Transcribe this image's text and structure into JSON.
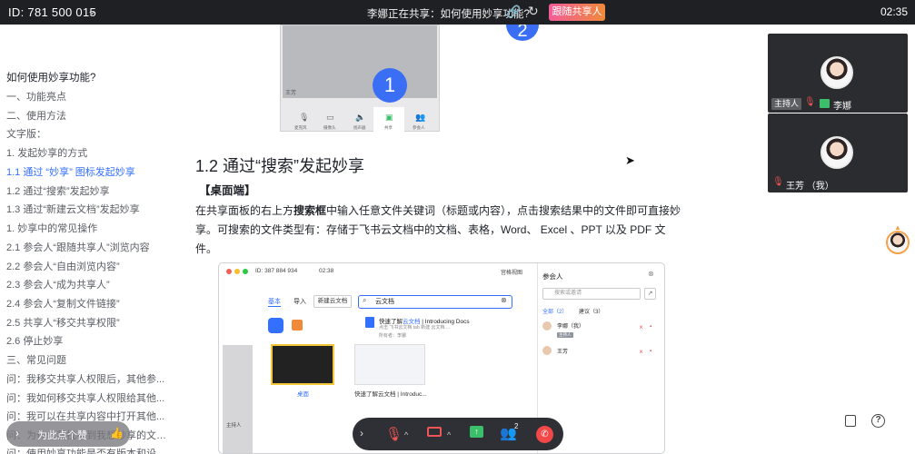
{
  "topbar": {
    "meeting_id": "ID: 781 500 015",
    "sharing_status": "李娜正在共享：如何使用妙享功能?",
    "follow_button": "跟随共享人",
    "clock": "02:35"
  },
  "outline": {
    "items": [
      "如何使用妙享功能?",
      "一、功能亮点",
      "二、使用方法",
      "文字版：",
      "1. 发起妙享的方式",
      "1.1 通过 “妙享” 图标发起妙享",
      "1.2 通过“搜索”发起妙享",
      "1.3 通过“新建云文档”发起妙享",
      "1. 妙享中的常见操作",
      "2.1 参会人“跟随共享人”浏览内容",
      "2.2 参会人“自由浏览内容”",
      "2.3 参会人“成为共享人”",
      "2.4 参会人“复制文件链接”",
      "2.5 共享人“移交共享权限”",
      "2.6 停止妙享",
      "三、常见问题",
      "问：我移交共享人权限后，其他参...",
      "问：我如何移交共享人权限给其他...",
      "问：我可以在共享内容中打开其他...",
      "问：为什么我找不到我想妙享的文件...",
      "问：使用妙享功能是否有版本和设..."
    ]
  },
  "doc": {
    "image1": {
      "user": "王芳",
      "badge": "1",
      "controls": [
        "麦克风",
        "摄像头",
        "扬声器",
        "共享",
        "参会人"
      ]
    },
    "badge2": "2",
    "heading": "1.2 通过“搜索”发起妙享",
    "subheading": "【桌面端】",
    "para_pre": "在共享面板的右上方",
    "para_bold": "搜索框",
    "para_post": "中输入任意文件关键词（标题或内容），点击搜索结果中的文件即可直接妙享。可搜索的文件类型有：存储于飞书云文档中的文档、表格，Word、 Excel 、PPT 以及 PDF 文件。"
  },
  "embed": {
    "meeting_id": "ID: 387 884 934",
    "time": "02:38",
    "view_mode": "宫格视图",
    "tabs": [
      "基本",
      "导入"
    ],
    "new_doc": "新建云文档",
    "search_value": "云文档",
    "result_title_pre": "快速了解",
    "result_title_hl": "云文档",
    "result_title_post": " | Introducing Docs",
    "result_desc": "点击 飞书云文档 tab 新建 云文档 ...",
    "result_owner": "所有者：李娜",
    "thumb1_caption": "桌面",
    "thumb2_caption": "快速了解云文档 | Introduc...",
    "left_label": "主持人",
    "panel_title": "参会人",
    "panel_search_placeholder": "搜索或邀请",
    "panel_tabs": [
      "全部（2）",
      "建议（3）"
    ],
    "participants": [
      {
        "name": "李娜（我）",
        "tag": "主持人"
      },
      {
        "name": "王芳",
        "tag": ""
      }
    ]
  },
  "videos": [
    {
      "host_tag": "主持人",
      "name": "李娜"
    },
    {
      "host_tag": "",
      "name": "王芳 （我）"
    }
  ],
  "bottombar": {
    "participant_count": "2"
  },
  "pill": {
    "text": "为此点个赞"
  }
}
